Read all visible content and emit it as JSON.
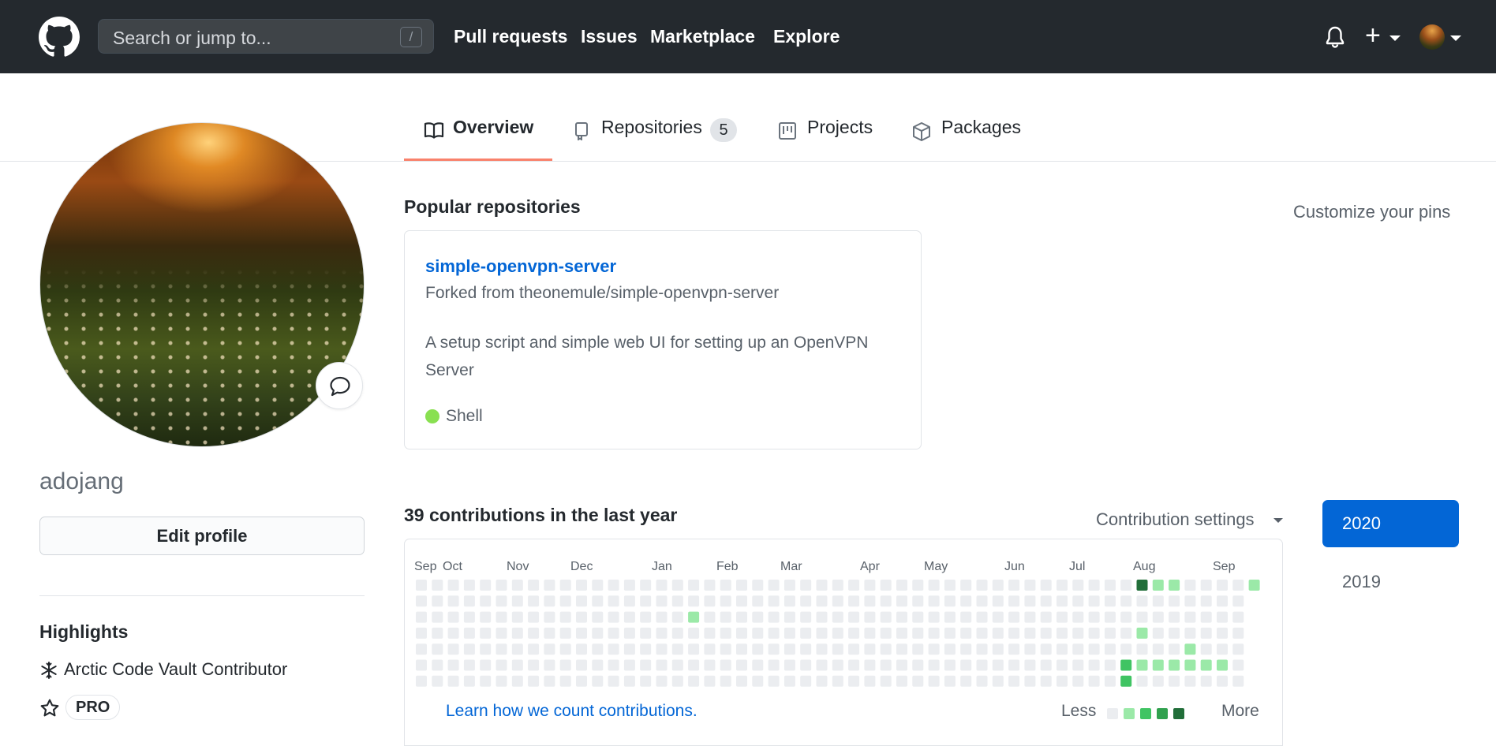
{
  "header": {
    "logo_icon": "github-mark-icon",
    "search_placeholder": "Search or jump to...",
    "search_shortcut": "/",
    "nav": [
      "Pull requests",
      "Issues",
      "Marketplace",
      "Explore"
    ],
    "icons": [
      "bell-icon",
      "plus-icon",
      "avatar"
    ]
  },
  "tabs": [
    {
      "label": "Overview",
      "icon": "book-icon",
      "active": true
    },
    {
      "label": "Repositories",
      "icon": "repo-icon",
      "count": "5"
    },
    {
      "label": "Projects",
      "icon": "project-icon"
    },
    {
      "label": "Packages",
      "icon": "package-icon"
    }
  ],
  "profile": {
    "username": "adojang",
    "edit_label": "Edit profile",
    "highlights_title": "Highlights",
    "highlights": [
      {
        "icon": "arctic-vault-icon",
        "label": "Arctic Code Vault Contributor"
      },
      {
        "icon": "star-icon",
        "label": "PRO"
      }
    ]
  },
  "pinned": {
    "title": "Popular repositories",
    "customize_label": "Customize your pins",
    "repo": {
      "name": "simple-openvpn-server",
      "forked_from": "Forked from theonemule/simple-openvpn-server",
      "description": "A setup script and simple web UI for setting up an OpenVPN Server",
      "language": "Shell",
      "language_color": "#89e051"
    }
  },
  "contributions": {
    "title": "39 contributions in the last year",
    "settings_label": "Contribution settings",
    "months": [
      "Sep",
      "Oct",
      "Nov",
      "Dec",
      "Jan",
      "Feb",
      "Mar",
      "Apr",
      "May",
      "Jun",
      "Jul",
      "Aug",
      "Sep"
    ],
    "learn_label": "Learn how we count contributions.",
    "legend_less": "Less",
    "legend_more": "More",
    "colors": [
      "#ebedf0",
      "#9be9a8",
      "#40c463",
      "#30a14e",
      "#216e39"
    ],
    "weeks": 53,
    "active_cells": [
      {
        "week": 17,
        "day": 2,
        "level": 1
      },
      {
        "week": 44,
        "day": 5,
        "level": 2
      },
      {
        "week": 44,
        "day": 6,
        "level": 2
      },
      {
        "week": 45,
        "day": 0,
        "level": 4
      },
      {
        "week": 45,
        "day": 3,
        "level": 1
      },
      {
        "week": 45,
        "day": 5,
        "level": 1
      },
      {
        "week": 46,
        "day": 0,
        "level": 1
      },
      {
        "week": 46,
        "day": 5,
        "level": 1
      },
      {
        "week": 47,
        "day": 0,
        "level": 1
      },
      {
        "week": 47,
        "day": 5,
        "level": 1
      },
      {
        "week": 48,
        "day": 4,
        "level": 1
      },
      {
        "week": 48,
        "day": 5,
        "level": 1
      },
      {
        "week": 49,
        "day": 5,
        "level": 1
      },
      {
        "week": 50,
        "day": 5,
        "level": 1
      },
      {
        "week": 52,
        "day": 0,
        "level": 1
      }
    ]
  },
  "years": {
    "active": "2020",
    "others": [
      "2019"
    ]
  }
}
